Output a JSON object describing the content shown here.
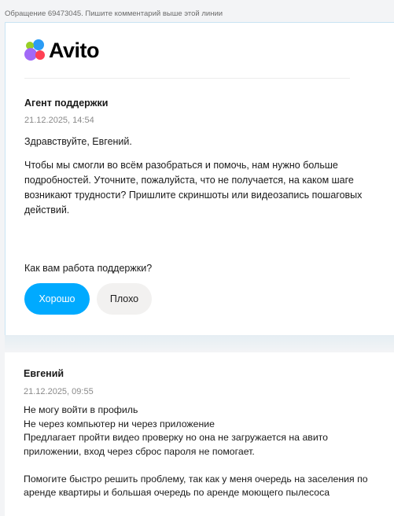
{
  "header": {
    "notice": "Обращение 69473045. Пишите комментарий выше этой линии"
  },
  "logo": {
    "text": "Avito"
  },
  "agent_message": {
    "author": "Агент поддержки",
    "date": "21.12.2025, 14:54",
    "greeting": "Здравствуйте, Евгений.",
    "body": "Чтобы мы смогли во всём разобраться и помочь, нам нужно больше подробностей. Уточните, пожалуйста, что не получается, на каком шаге возникают трудности? Пришлите скриншоты или видеозапись пошаговых действий."
  },
  "rating": {
    "question": "Как вам работа поддержки?",
    "good_label": "Хорошо",
    "bad_label": "Плохо",
    "good_color": "#00aaff"
  },
  "user_message": {
    "author": "Евгений",
    "date": "21.12.2025, 09:55",
    "lines": [
      "Не могу войти в профиль",
      "Не через компьютер ни через приложение",
      "Предлагает пройти видео проверку но она не загружается на авито приложении, вход через сброс пароля не помогает."
    ],
    "closing": "Помогите быстро решить проблему, так как у меня очередь на заселения по аренде квартиры и большая очередь по аренде моющего пылесоса"
  }
}
